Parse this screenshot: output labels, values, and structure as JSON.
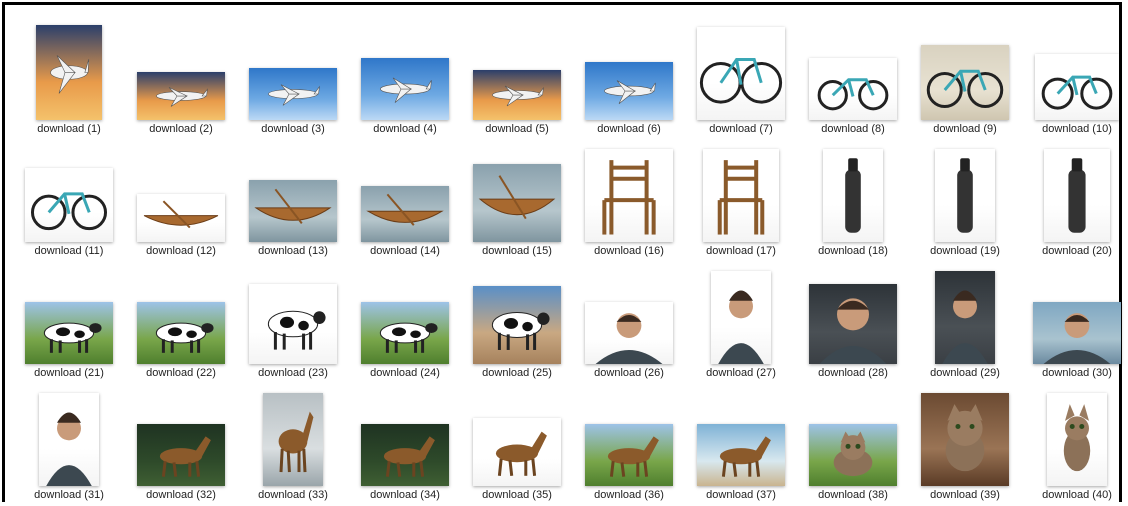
{
  "items": [
    {
      "label": "download (1)",
      "subject": "airplane",
      "scene": "sunset",
      "icon": "airplane-icon"
    },
    {
      "label": "download (2)",
      "subject": "airplane",
      "scene": "sunset",
      "icon": "airplane-icon"
    },
    {
      "label": "download (3)",
      "subject": "airplane",
      "scene": "sky",
      "icon": "airplane-icon"
    },
    {
      "label": "download (4)",
      "subject": "airplane",
      "scene": "sky",
      "icon": "airplane-icon"
    },
    {
      "label": "download (5)",
      "subject": "airplane",
      "scene": "sunset",
      "icon": "airplane-icon"
    },
    {
      "label": "download (6)",
      "subject": "airplane",
      "scene": "sky",
      "icon": "airplane-icon"
    },
    {
      "label": "download (7)",
      "subject": "bicycle",
      "scene": "white",
      "icon": "bicycle-icon"
    },
    {
      "label": "download (8)",
      "subject": "bicycle",
      "scene": "white",
      "icon": "bicycle-icon"
    },
    {
      "label": "download (9)",
      "subject": "bicycle",
      "scene": "studio",
      "icon": "bicycle-icon"
    },
    {
      "label": "download (10)",
      "subject": "bicycle",
      "scene": "white",
      "icon": "bicycle-icon"
    },
    {
      "label": "download (11)",
      "subject": "bicycle",
      "scene": "white",
      "icon": "bicycle-icon"
    },
    {
      "label": "download (12)",
      "subject": "boat",
      "scene": "white",
      "icon": "boat-icon"
    },
    {
      "label": "download (13)",
      "subject": "boat",
      "scene": "water",
      "icon": "boat-icon"
    },
    {
      "label": "download (14)",
      "subject": "boat",
      "scene": "water",
      "icon": "boat-icon"
    },
    {
      "label": "download (15)",
      "subject": "boat",
      "scene": "water",
      "icon": "boat-icon"
    },
    {
      "label": "download (16)",
      "subject": "chair",
      "scene": "white",
      "icon": "chair-icon"
    },
    {
      "label": "download (17)",
      "subject": "chair",
      "scene": "white",
      "icon": "chair-icon"
    },
    {
      "label": "download (18)",
      "subject": "bottle",
      "scene": "white",
      "icon": "bottle-icon"
    },
    {
      "label": "download (19)",
      "subject": "bottle",
      "scene": "white",
      "icon": "bottle-icon"
    },
    {
      "label": "download (20)",
      "subject": "bottle",
      "scene": "white",
      "icon": "bottle-icon"
    },
    {
      "label": "download (21)",
      "subject": "cow",
      "scene": "field",
      "icon": "cow-icon"
    },
    {
      "label": "download (22)",
      "subject": "cow",
      "scene": "field",
      "icon": "cow-icon"
    },
    {
      "label": "download (23)",
      "subject": "cow",
      "scene": "white",
      "icon": "cow-icon"
    },
    {
      "label": "download (24)",
      "subject": "cow",
      "scene": "field",
      "icon": "cow-icon"
    },
    {
      "label": "download (25)",
      "subject": "cow",
      "scene": "outdoor",
      "icon": "cow-icon"
    },
    {
      "label": "download (26)",
      "subject": "person",
      "scene": "white",
      "icon": "person-icon"
    },
    {
      "label": "download (27)",
      "subject": "person",
      "scene": "white",
      "icon": "person-icon"
    },
    {
      "label": "download (28)",
      "subject": "person",
      "scene": "dark",
      "icon": "person-icon"
    },
    {
      "label": "download (29)",
      "subject": "person",
      "scene": "dark",
      "icon": "person-icon"
    },
    {
      "label": "download (30)",
      "subject": "person",
      "scene": "lake",
      "icon": "person-icon"
    },
    {
      "label": "download (31)",
      "subject": "person",
      "scene": "white",
      "icon": "person-icon"
    },
    {
      "label": "download (32)",
      "subject": "horse",
      "scene": "forest",
      "icon": "horse-icon"
    },
    {
      "label": "download (33)",
      "subject": "horse",
      "scene": "snow",
      "icon": "horse-icon"
    },
    {
      "label": "download (34)",
      "subject": "horse",
      "scene": "forest",
      "icon": "horse-icon"
    },
    {
      "label": "download (35)",
      "subject": "horse",
      "scene": "white",
      "icon": "horse-icon"
    },
    {
      "label": "download (36)",
      "subject": "horse",
      "scene": "field",
      "icon": "horse-icon"
    },
    {
      "label": "download (37)",
      "subject": "horse",
      "scene": "beach",
      "icon": "horse-icon"
    },
    {
      "label": "download (38)",
      "subject": "cat",
      "scene": "field",
      "icon": "cat-icon"
    },
    {
      "label": "download (39)",
      "subject": "cat",
      "scene": "closeup",
      "icon": "cat-icon"
    },
    {
      "label": "download (40)",
      "subject": "cat",
      "scene": "white",
      "icon": "cat-icon"
    }
  ]
}
